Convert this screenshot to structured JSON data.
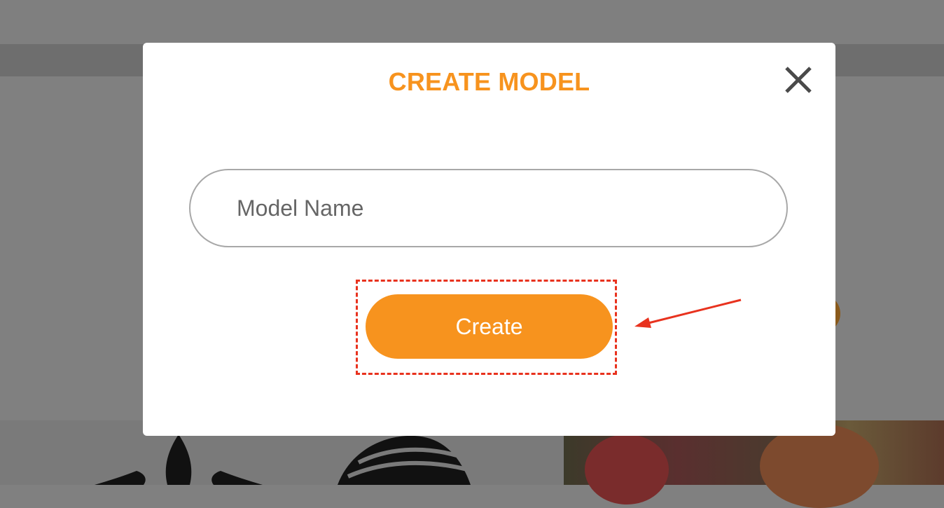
{
  "modal": {
    "title": "CREATE MODEL",
    "close_icon": "close-icon",
    "input": {
      "placeholder": "Model Name",
      "value": ""
    },
    "create_label": "Create"
  },
  "annotation": {
    "highlight_color": "#e8321e",
    "arrow_icon": "arrow-icon"
  },
  "colors": {
    "accent": "#f7931e",
    "overlay": "#808080",
    "modal_bg": "#ffffff"
  }
}
